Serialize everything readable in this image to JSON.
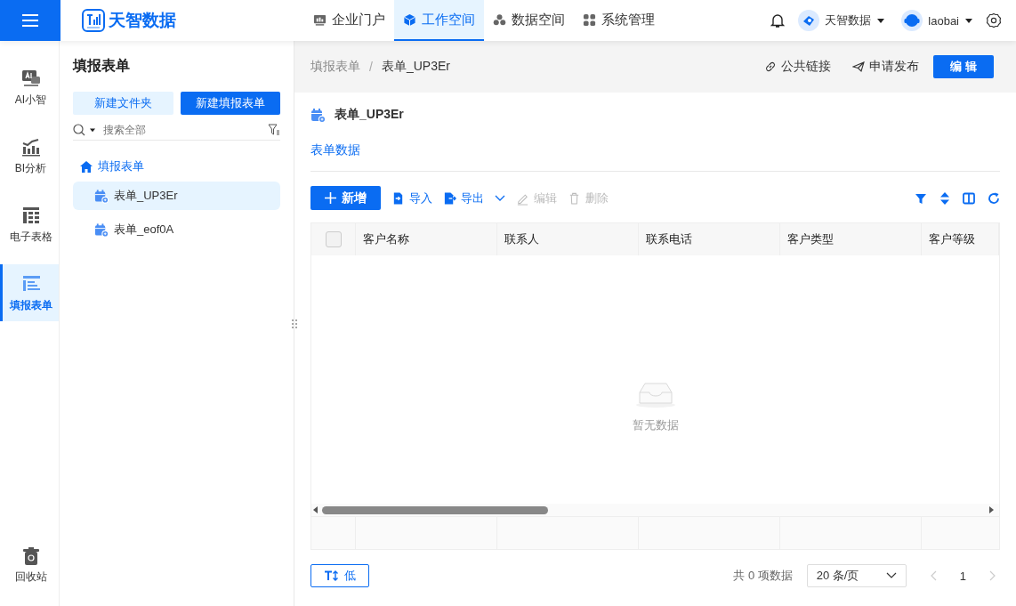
{
  "logo": {
    "text": "天智数据"
  },
  "nav": [
    {
      "label": "企业门户",
      "selected": false
    },
    {
      "label": "工作空间",
      "selected": true
    },
    {
      "label": "数据空间",
      "selected": false
    },
    {
      "label": "系统管理",
      "selected": false
    }
  ],
  "header_right": {
    "org": "天智数据",
    "user": "laobai"
  },
  "rail": {
    "items": [
      {
        "label": "AI小智",
        "selected": false
      },
      {
        "label": "BI分析",
        "selected": false
      },
      {
        "label": "电子表格",
        "selected": false
      },
      {
        "label": "填报表单",
        "selected": true
      }
    ],
    "bottom": "回收站"
  },
  "panel": {
    "title": "填报表单",
    "buttons": [
      "新建文件夹",
      "新建填报表单"
    ],
    "search": {
      "placeholder": "搜索全部"
    },
    "tree": [
      {
        "label": "填报表单",
        "children": [
          {
            "label": "表单_UP3Er",
            "selected": true
          },
          {
            "label": "表单_eof0A",
            "selected": false
          }
        ]
      }
    ]
  },
  "breadcrumb": [
    "填报表单",
    "表单_UP3Er"
  ],
  "breadcrumb_separator": "/",
  "actions": [
    "公共链接",
    "申请发布"
  ],
  "edit_button": "编 辑",
  "form": {
    "title": "表单_UP3Er",
    "tabs": [
      {
        "label": "表单数据",
        "selected": true
      }
    ]
  },
  "toolbar": {
    "add": "新增",
    "items": [
      {
        "label": "导入",
        "disabled": false,
        "kind": "button"
      },
      {
        "label": "导出",
        "disabled": false,
        "kind": "menu"
      },
      {
        "label": "编辑",
        "disabled": true,
        "kind": "button"
      },
      {
        "label": "删除",
        "disabled": true,
        "kind": "button"
      }
    ]
  },
  "table": {
    "header_checkbox": {
      "checked": false
    },
    "columns": [
      "客户名称",
      "联系人",
      "联系电话",
      "客户类型",
      "客户等级"
    ],
    "empty_text": "暂无数据"
  },
  "footer": {
    "density_button": "低",
    "total": "共 0 项数据",
    "page_size": "20 条/页",
    "page": "1"
  }
}
